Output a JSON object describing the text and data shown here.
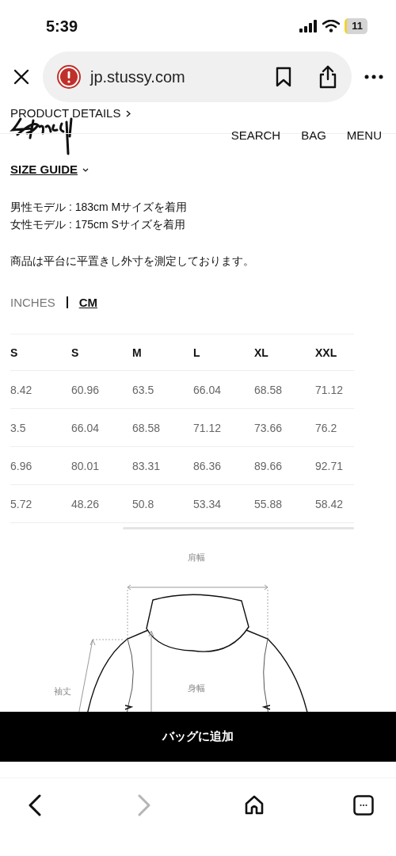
{
  "status_bar": {
    "time": "5:39",
    "battery": "11"
  },
  "browser": {
    "url": "jp.stussy.com"
  },
  "site_header": {
    "breadcrumb": "PRODUCT DETAILS",
    "nav": [
      "SEARCH",
      "BAG",
      "MENU"
    ]
  },
  "size_guide": {
    "title": "SIZE GUIDE",
    "models": [
      "男性モデル : 183cm Mサイズを着用",
      "女性モデル : 175cm Sサイズを着用"
    ],
    "note": "商品は平台に平置きし外寸を測定しております。",
    "units": [
      {
        "label": "INCHES",
        "selected": false
      },
      {
        "label": "CM",
        "selected": true
      }
    ],
    "table": {
      "columns": [
        "S",
        "S",
        "M",
        "L",
        "XL",
        "XXL"
      ],
      "rows": [
        [
          "8.42",
          "60.96",
          "63.5",
          "66.04",
          "68.58",
          "71.12"
        ],
        [
          "3.5",
          "66.04",
          "68.58",
          "71.12",
          "73.66",
          "76.2"
        ],
        [
          "6.96",
          "80.01",
          "83.31",
          "86.36",
          "89.66",
          "92.71"
        ],
        [
          "5.72",
          "48.26",
          "50.8",
          "53.34",
          "55.88",
          "58.42"
        ]
      ]
    },
    "diagram": {
      "labels": [
        {
          "kind": "shoulder",
          "text": "肩幅"
        },
        {
          "kind": "sleeve",
          "text": "袖丈"
        },
        {
          "kind": "chest",
          "text": "身幅"
        }
      ]
    }
  },
  "add_to_bag": "バッグに追加",
  "toolbar": [
    {
      "kind": "back",
      "disabled": false
    },
    {
      "kind": "forward",
      "disabled": true
    },
    {
      "kind": "home",
      "disabled": false
    },
    {
      "kind": "tabs",
      "disabled": false
    }
  ]
}
